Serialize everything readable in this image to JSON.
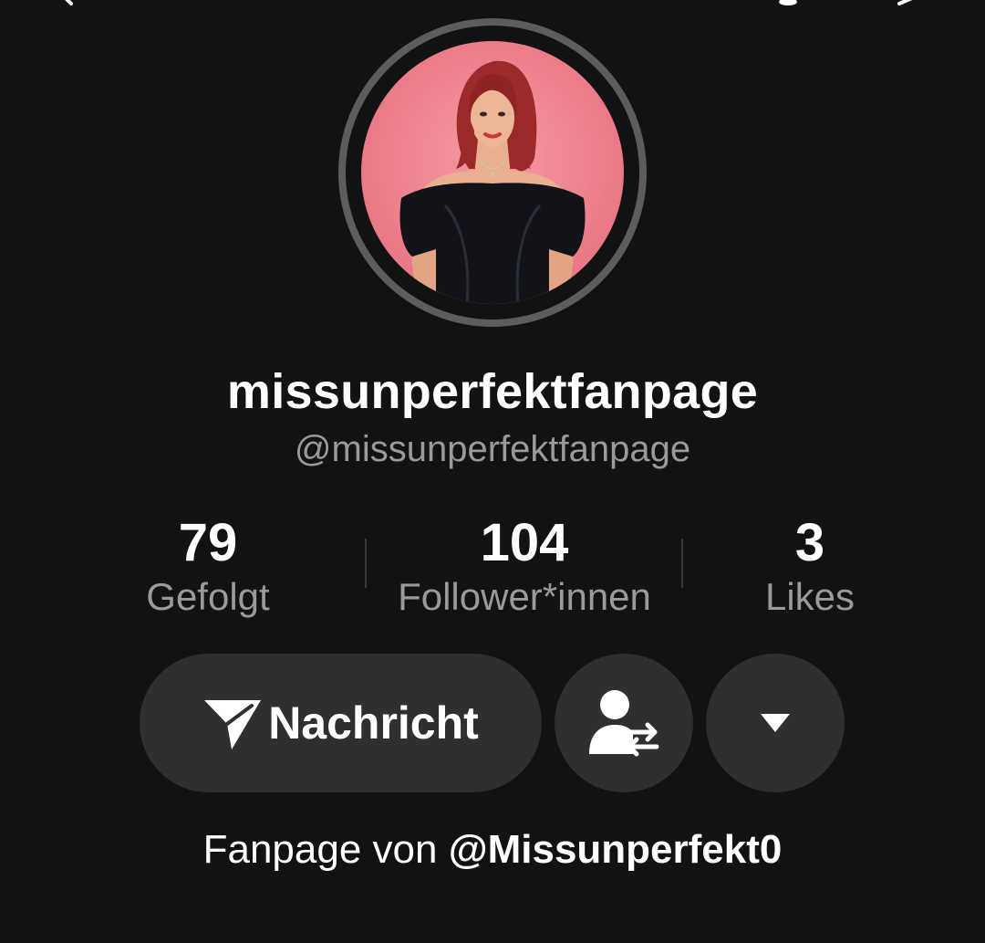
{
  "profile": {
    "display_name": "missunperfektfanpage",
    "username": "@missunperfektfanpage",
    "avatar_background": "#ee7f8d"
  },
  "stats": [
    {
      "value": "79",
      "label": "Gefolgt"
    },
    {
      "value": "104",
      "label": "Follower*innen"
    },
    {
      "value": "3",
      "label": "Likes"
    }
  ],
  "actions": {
    "message_label": "Nachricht",
    "message_icon": "send-icon",
    "suggest_icon": "person-swap-icon",
    "more_icon": "triangle-down-icon"
  },
  "bio": {
    "prefix": "Fanpage von ",
    "mention": "@Missunperfekt0"
  },
  "colors": {
    "background": "#121212",
    "button": "#2f2f2f",
    "secondary_text": "#9a9a9a"
  }
}
